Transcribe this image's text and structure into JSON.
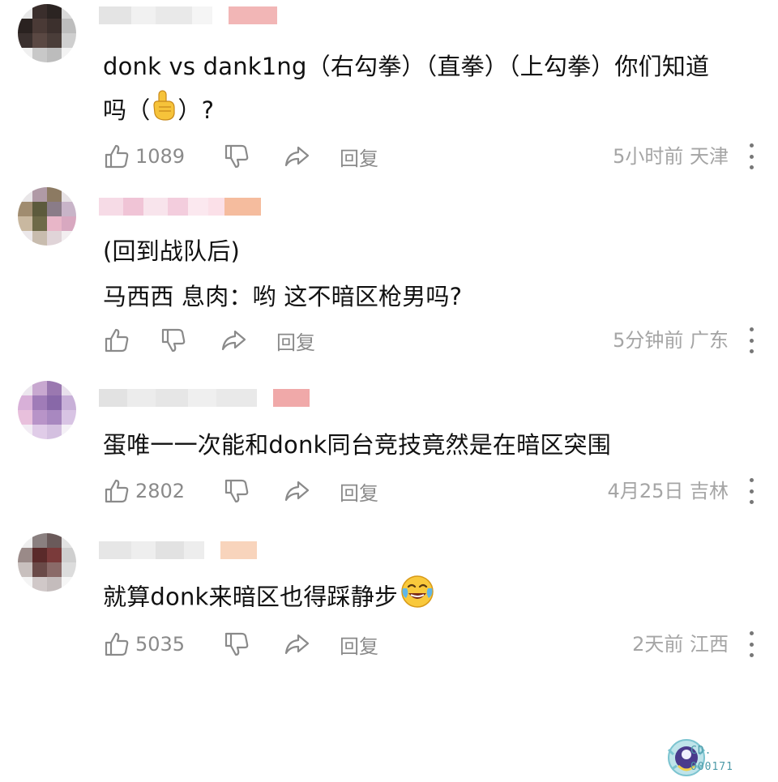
{
  "comments": [
    {
      "lines": [
        "donk vs dank1ng（右勾拳）（直拳）（上勾拳）你们知道",
        "吗（",
        "）?"
      ],
      "likes": "1089",
      "reply_label": "回复",
      "time": "5小时前",
      "location": "天津"
    },
    {
      "lines": [
        "(回到战队后)",
        "马西西 息肉：哟 这不暗区枪男吗?"
      ],
      "likes": "",
      "reply_label": "回复",
      "time": "5分钟前",
      "location": "广东"
    },
    {
      "lines": [
        "蛋唯一一次能和donk同台竞技竟然是在暗区突围"
      ],
      "likes": "2802",
      "reply_label": "回复",
      "time": "4月25日",
      "location": "吉林",
      "badge_lines": [
        "CD.",
        "000171"
      ]
    },
    {
      "lines": [
        "就算donk来暗区也得踩静步"
      ],
      "likes": "5035",
      "reply_label": "回复",
      "time": "2天前",
      "location": "江西"
    }
  ],
  "icons": {
    "like": "thumbs-up-icon",
    "dislike": "thumbs-down-icon",
    "share": "share-arrow-icon",
    "more": "more-vertical-icon",
    "emoji1": "pointing-up-emoji",
    "emoji2": "laughing-tears-emoji"
  },
  "colors": {
    "text": "#111111",
    "meta": "#a5a5a5",
    "action": "#8a8a8a",
    "badge": "#4c9aa8"
  }
}
